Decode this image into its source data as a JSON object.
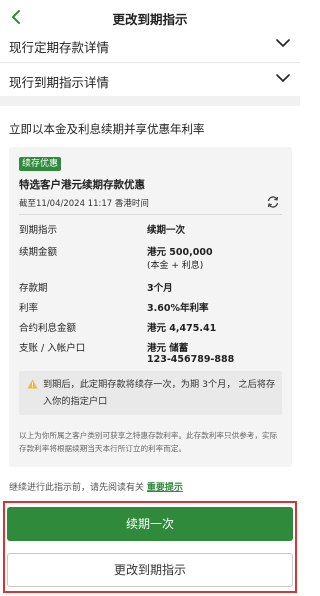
{
  "header": {
    "title": "更改到期指示"
  },
  "accordions": [
    {
      "label": "现行定期存款详情"
    },
    {
      "label": "现行到期指示详情"
    }
  ],
  "promo": {
    "heading": "立即以本金及利息续期并享优惠年利率",
    "badge": "续存优惠",
    "title": "特选客户港元续期存款优惠",
    "as_of": "截至11/04/2024 11:17 香港时间",
    "details": [
      {
        "key": "到期指示",
        "value": "续期一次"
      },
      {
        "key": "续期金额",
        "value": "港元 500,000",
        "sub": "(本金 + 利息)"
      },
      {
        "key": "存款期",
        "value": "3个月"
      },
      {
        "key": "利率",
        "value": "3.60%年利率"
      },
      {
        "key": "合约利息金额",
        "value": "港元 4,475.41"
      },
      {
        "key": "支账 / 入帐户口",
        "value": "港元 储蓄",
        "sub": "123-456789-888"
      }
    ],
    "notice": "到期后，此定期存款将续存一次，为期 3个月， 之后将存入你的指定户口",
    "disclaimer": "以上为你所属之客户类别可获享之特惠存款利率。此存款利率只供参考，实际存款利率将根据续期当天本行所订立的利率而定。"
  },
  "footer": {
    "read_prefix": "继续进行此指示前，请先阅读有关",
    "read_link": "重要提示",
    "primary_button": "续期一次",
    "secondary_button": "更改到期指示"
  },
  "colors": {
    "accent": "#2f8a3b",
    "highlight": "#d83434"
  }
}
